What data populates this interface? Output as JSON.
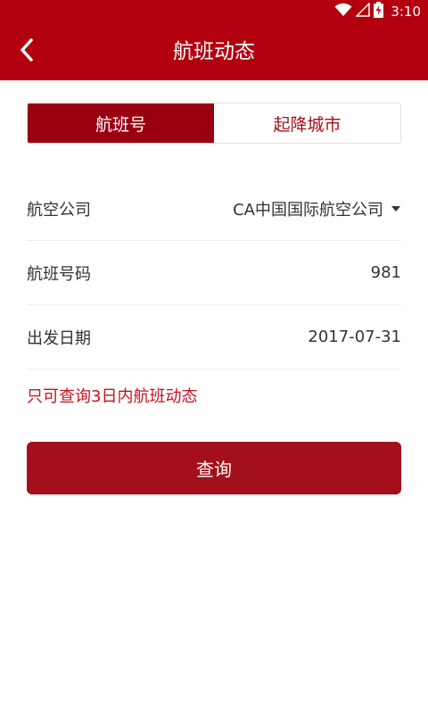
{
  "status_bar": {
    "time": "3:10",
    "icons": [
      "wifi-icon",
      "signal-icon",
      "battery-charging-icon"
    ]
  },
  "app_bar": {
    "title": "航班动态",
    "back_icon": "chevron-left-icon"
  },
  "tabs": [
    {
      "label": "航班号",
      "active": true
    },
    {
      "label": "起降城市",
      "active": false
    }
  ],
  "form": {
    "airline": {
      "label": "航空公司",
      "value": "CA中国国际航空公司",
      "icon": "triangle-down-icon"
    },
    "flight_number": {
      "label": "航班号码",
      "value": "981"
    },
    "departure_date": {
      "label": "出发日期",
      "value": "2017-07-31"
    }
  },
  "hint": "只可查询3日内航班动态",
  "query_button": {
    "label": "查询"
  },
  "colors": {
    "brand": "#b3000f",
    "tab_active": "#9b0011",
    "button": "#a3101c",
    "hint_text": "#c8101f"
  }
}
